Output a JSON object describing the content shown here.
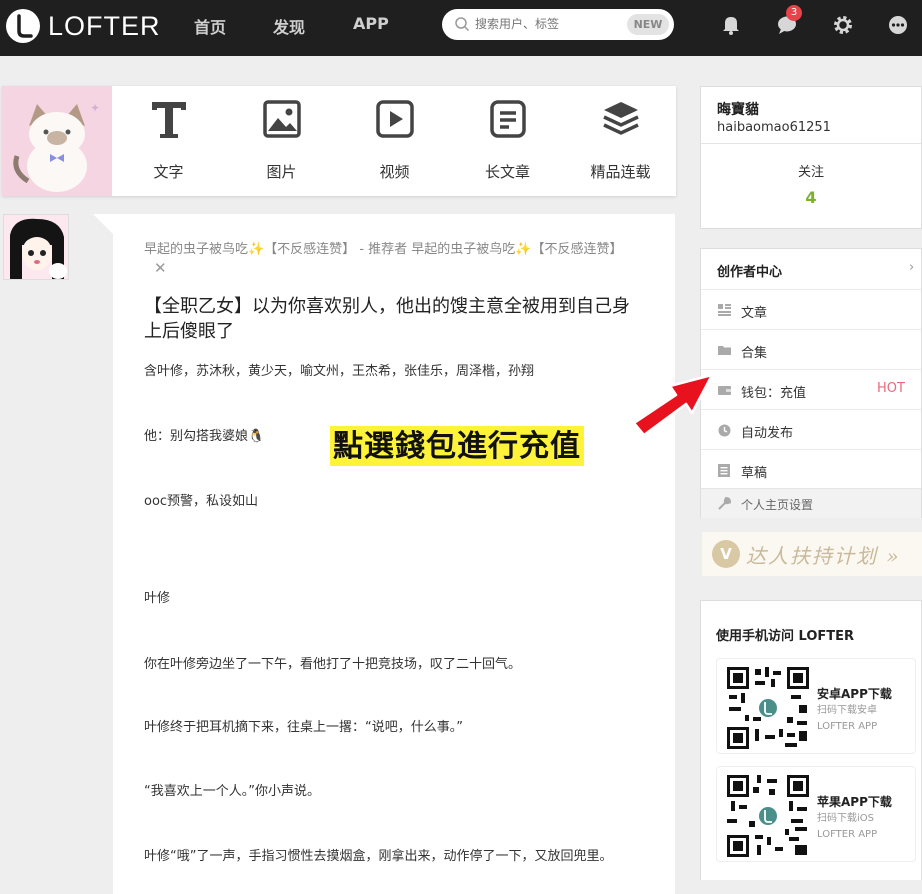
{
  "header": {
    "logo_text": "LOFTER",
    "nav": [
      "首页",
      "发现",
      "APP"
    ],
    "search_placeholder": "搜索用户、标签",
    "search_badge": "NEW",
    "message_count": "3"
  },
  "publish": {
    "buttons": [
      {
        "label": "文字",
        "icon": "text-icon"
      },
      {
        "label": "图片",
        "icon": "image-icon"
      },
      {
        "label": "视频",
        "icon": "video-icon"
      },
      {
        "label": "长文章",
        "icon": "article-icon"
      },
      {
        "label": "精品连载",
        "icon": "layers-icon"
      }
    ]
  },
  "post": {
    "meta": "早起的虫子被鸟吃✨【不反感连赞】 - 推荐者 早起的虫子被鸟吃✨【不反感连赞】",
    "dismiss": "✕",
    "title": "【全职乙女】以为你喜欢别人，他出的馊主意全被用到自己身上后傻眼了",
    "lines": [
      "含叶修，苏沐秋，黄少天，喻文州，王杰希，张佳乐，周泽楷，孙翔",
      "他：别勾搭我婆娘🐧",
      "ooc预警，私设如山",
      "叶修",
      "你在叶修旁边坐了一下午，看他打了十把竞技场，叹了二十回气。",
      "叶修终于把耳机摘下来，往桌上一撂：“说吧，什么事。”",
      "“我喜欢上一个人。”你小声说。",
      "叶修“哦”了一声，手指习惯性去摸烟盒，刚拿出来，动作停了一下，又放回兜里。"
    ]
  },
  "user": {
    "name": "晦寶貓",
    "id": "haibaomao61251",
    "follow_label": "关注",
    "follow_count": "4"
  },
  "creator": {
    "title": "创作者中心",
    "items": [
      {
        "label": "文章",
        "icon": "article-list-icon"
      },
      {
        "label": "合集",
        "icon": "folder-icon"
      },
      {
        "label": "钱包：充值",
        "icon": "wallet-icon",
        "badge": "HOT"
      },
      {
        "label": "自动发布",
        "icon": "clock-icon"
      },
      {
        "label": "草稿",
        "icon": "draft-icon"
      }
    ],
    "settings": "个人主页设置"
  },
  "banner": {
    "logo": "V",
    "text": "达人扶持计划 »"
  },
  "mobile": {
    "title": "使用手机访问 LOFTER",
    "android": {
      "title": "安卓APP下载",
      "sub1": "扫码下载安卓",
      "sub2": "LOFTER APP"
    },
    "ios": {
      "title": "苹果APP下载",
      "sub1": "扫码下载iOS",
      "sub2": "LOFTER APP"
    }
  },
  "annotation": {
    "text": "點選錢包進行充值"
  },
  "colors": {
    "topbar": "#1f1f1f",
    "accent_green": "#7bb032",
    "hot": "#e8697d",
    "callout_bg": "#fff33a",
    "arrow": "#e8121f"
  }
}
